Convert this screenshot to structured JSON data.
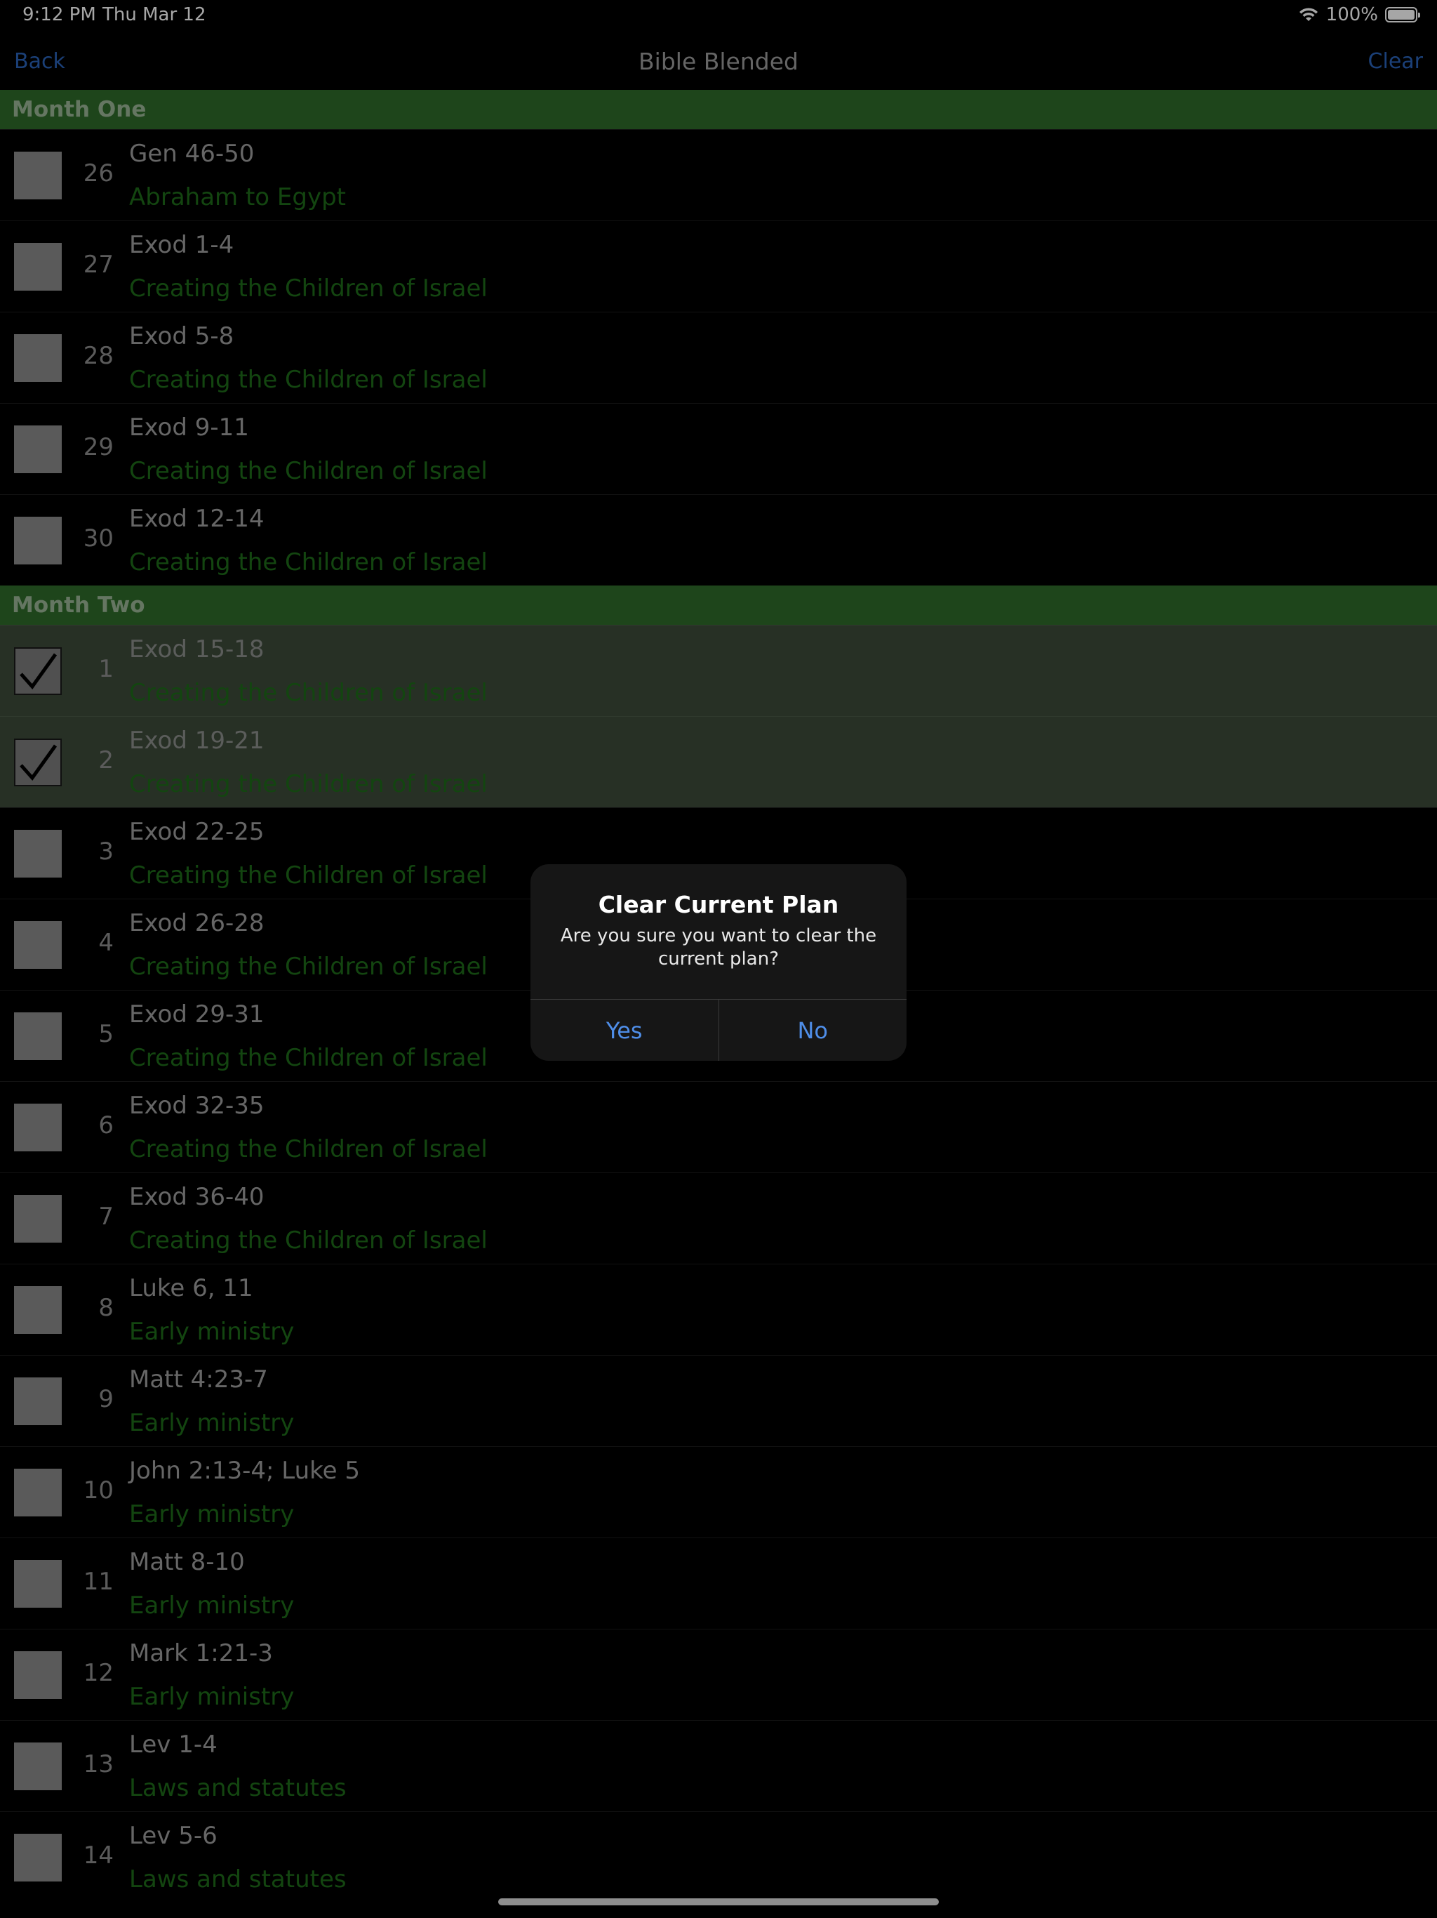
{
  "status_bar": {
    "time": "9:12 PM",
    "date": "Thu Mar 12",
    "battery": "100%"
  },
  "nav": {
    "back_label": "Back",
    "title": "Bible Blended",
    "clear_label": "Clear"
  },
  "sections": [
    {
      "title": "Month One",
      "items": [
        {
          "day": "26",
          "reference": "Gen 46-50",
          "theme": "Abraham to Egypt",
          "checked": false
        },
        {
          "day": "27",
          "reference": "Exod 1-4",
          "theme": "Creating the Children of Israel",
          "checked": false
        },
        {
          "day": "28",
          "reference": "Exod 5-8",
          "theme": "Creating the Children of Israel",
          "checked": false
        },
        {
          "day": "29",
          "reference": "Exod 9-11",
          "theme": "Creating the Children of Israel",
          "checked": false
        },
        {
          "day": "30",
          "reference": "Exod 12-14",
          "theme": "Creating the Children of Israel",
          "checked": false
        }
      ]
    },
    {
      "title": "Month Two",
      "items": [
        {
          "day": "1",
          "reference": "Exod 15-18",
          "theme": "Creating the Children of Israel",
          "checked": true
        },
        {
          "day": "2",
          "reference": "Exod 19-21",
          "theme": "Creating the Children of Israel",
          "checked": true
        },
        {
          "day": "3",
          "reference": "Exod 22-25",
          "theme": "Creating the Children of Israel",
          "checked": false
        },
        {
          "day": "4",
          "reference": "Exod 26-28",
          "theme": "Creating the Children of Israel",
          "checked": false
        },
        {
          "day": "5",
          "reference": "Exod 29-31",
          "theme": "Creating the Children of Israel",
          "checked": false
        },
        {
          "day": "6",
          "reference": "Exod 32-35",
          "theme": "Creating the Children of Israel",
          "checked": false
        },
        {
          "day": "7",
          "reference": "Exod 36-40",
          "theme": "Creating the Children of Israel",
          "checked": false
        },
        {
          "day": "8",
          "reference": "Luke 6, 11",
          "theme": "Early ministry",
          "checked": false
        },
        {
          "day": "9",
          "reference": "Matt 4:23-7",
          "theme": "Early ministry",
          "checked": false
        },
        {
          "day": "10",
          "reference": "John 2:13-4; Luke 5",
          "theme": "Early ministry",
          "checked": false
        },
        {
          "day": "11",
          "reference": "Matt 8-10",
          "theme": "Early ministry",
          "checked": false
        },
        {
          "day": "12",
          "reference": "Mark 1:21-3",
          "theme": "Early ministry",
          "checked": false
        },
        {
          "day": "13",
          "reference": "Lev 1-4",
          "theme": "Laws and statutes",
          "checked": false
        },
        {
          "day": "14",
          "reference": "Lev 5-6",
          "theme": "Laws and statutes",
          "checked": false
        }
      ]
    }
  ],
  "alert": {
    "title": "Clear Current Plan",
    "message": "Are you sure you want to clear the current plan?",
    "yes_label": "Yes",
    "no_label": "No"
  },
  "colors": {
    "section_header_bg": "#2f6b2a",
    "theme_text": "#1e6b1a",
    "link_blue": "#2a63b8",
    "alert_button_blue": "#4f8ee8",
    "completed_row_bg": "#3c4a3a"
  }
}
